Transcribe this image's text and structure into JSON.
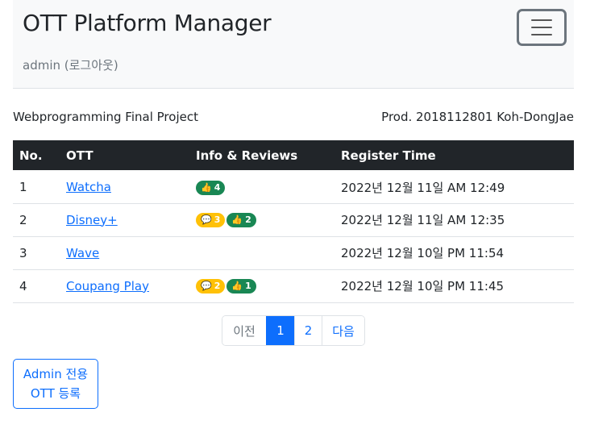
{
  "navbar": {
    "brand": "OTT Platform Manager",
    "user_link": "admin (로그아웃)",
    "toggler_icon": "hamburger-menu-icon"
  },
  "meta": {
    "project": "Webprogramming Final Project",
    "author": "Prod. 2018112801 Koh-DongJae"
  },
  "table": {
    "headers": [
      "No.",
      "OTT",
      "Info & Reviews",
      "Register Time"
    ],
    "rows": [
      {
        "no": "1",
        "ott": "Watcha",
        "reviews": null,
        "likes": "4",
        "time": "2022년 12월 11일 AM 12:49"
      },
      {
        "no": "2",
        "ott": "Disney+",
        "reviews": "3",
        "likes": "2",
        "time": "2022년 12월 11일 AM 12:35"
      },
      {
        "no": "3",
        "ott": "Wave",
        "reviews": null,
        "likes": null,
        "time": "2022년 12월 10일 PM 11:54"
      },
      {
        "no": "4",
        "ott": "Coupang Play",
        "reviews": "2",
        "likes": "1",
        "time": "2022년 12월 10일 PM 11:45"
      }
    ]
  },
  "pagination": {
    "prev": "이전",
    "pages": [
      "1",
      "2"
    ],
    "active_page": "1",
    "next": "다음"
  },
  "admin_button": {
    "line1": "Admin 전용",
    "line2": "OTT 등록"
  },
  "colors": {
    "primary": "#0d6efd",
    "dark": "#212529",
    "success": "#198754",
    "warning": "#ffc107"
  }
}
